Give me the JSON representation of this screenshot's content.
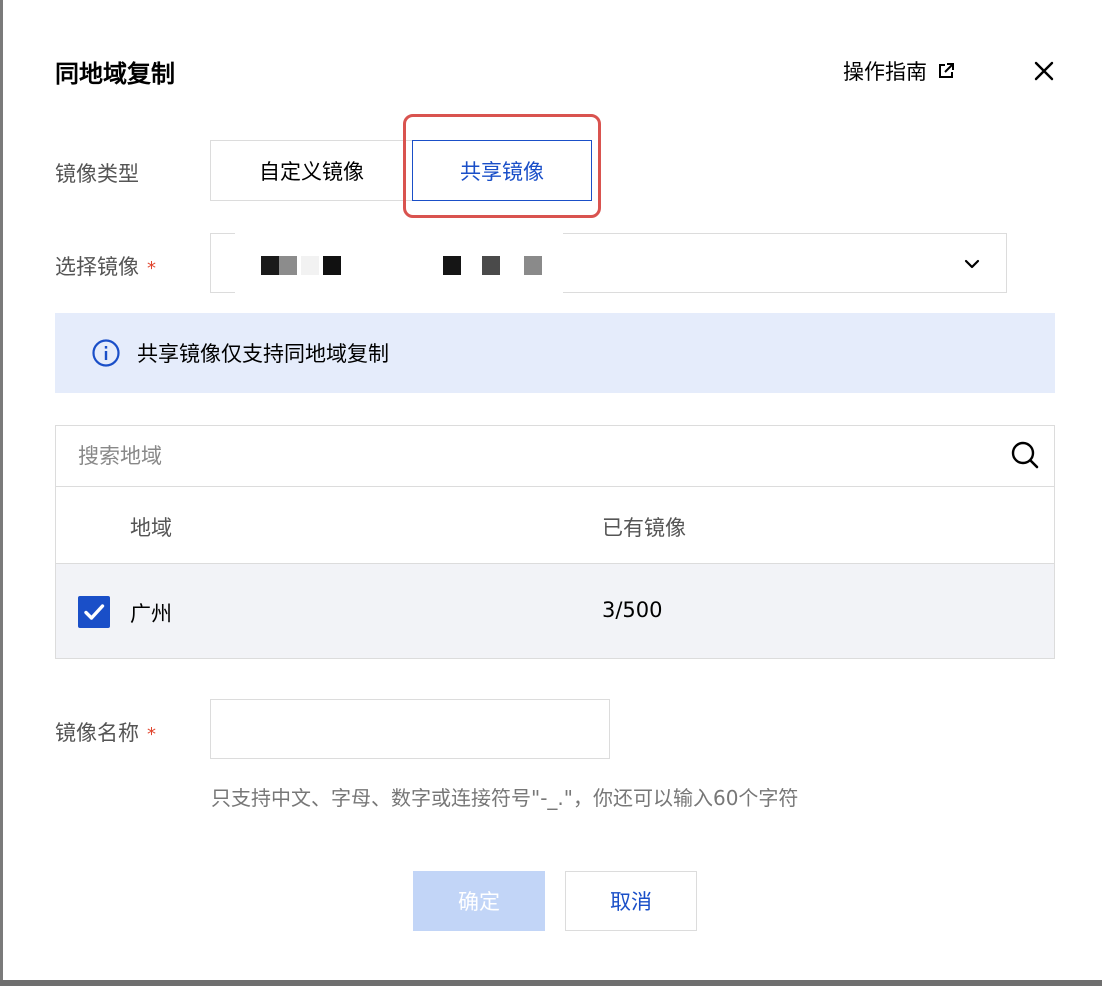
{
  "dialog": {
    "title": "同地域复制",
    "guide_label": "操作指南"
  },
  "image_type": {
    "label": "镜像类型",
    "options": [
      "自定义镜像",
      "共享镜像"
    ],
    "selected": "共享镜像"
  },
  "select_image": {
    "label": "选择镜像",
    "required_mark": "*"
  },
  "banner": {
    "text": "共享镜像仅支持同地域复制"
  },
  "region_table": {
    "search_placeholder": "搜索地域",
    "columns": [
      "地域",
      "已有镜像"
    ],
    "rows": [
      {
        "region": "广州",
        "count": "3/500",
        "checked": true
      }
    ]
  },
  "image_name": {
    "label": "镜像名称",
    "required_mark": "*",
    "value": "",
    "hint": "只支持中文、字母、数字或连接符号\"-_.\"，你还可以输入60个字符"
  },
  "footer": {
    "ok_label": "确定",
    "cancel_label": "取消"
  },
  "colors": {
    "accent": "#1a4fc8",
    "banner_bg": "#e5ecfb",
    "highlight": "#d9534f",
    "ok_disabled": "#c2d5f7"
  }
}
